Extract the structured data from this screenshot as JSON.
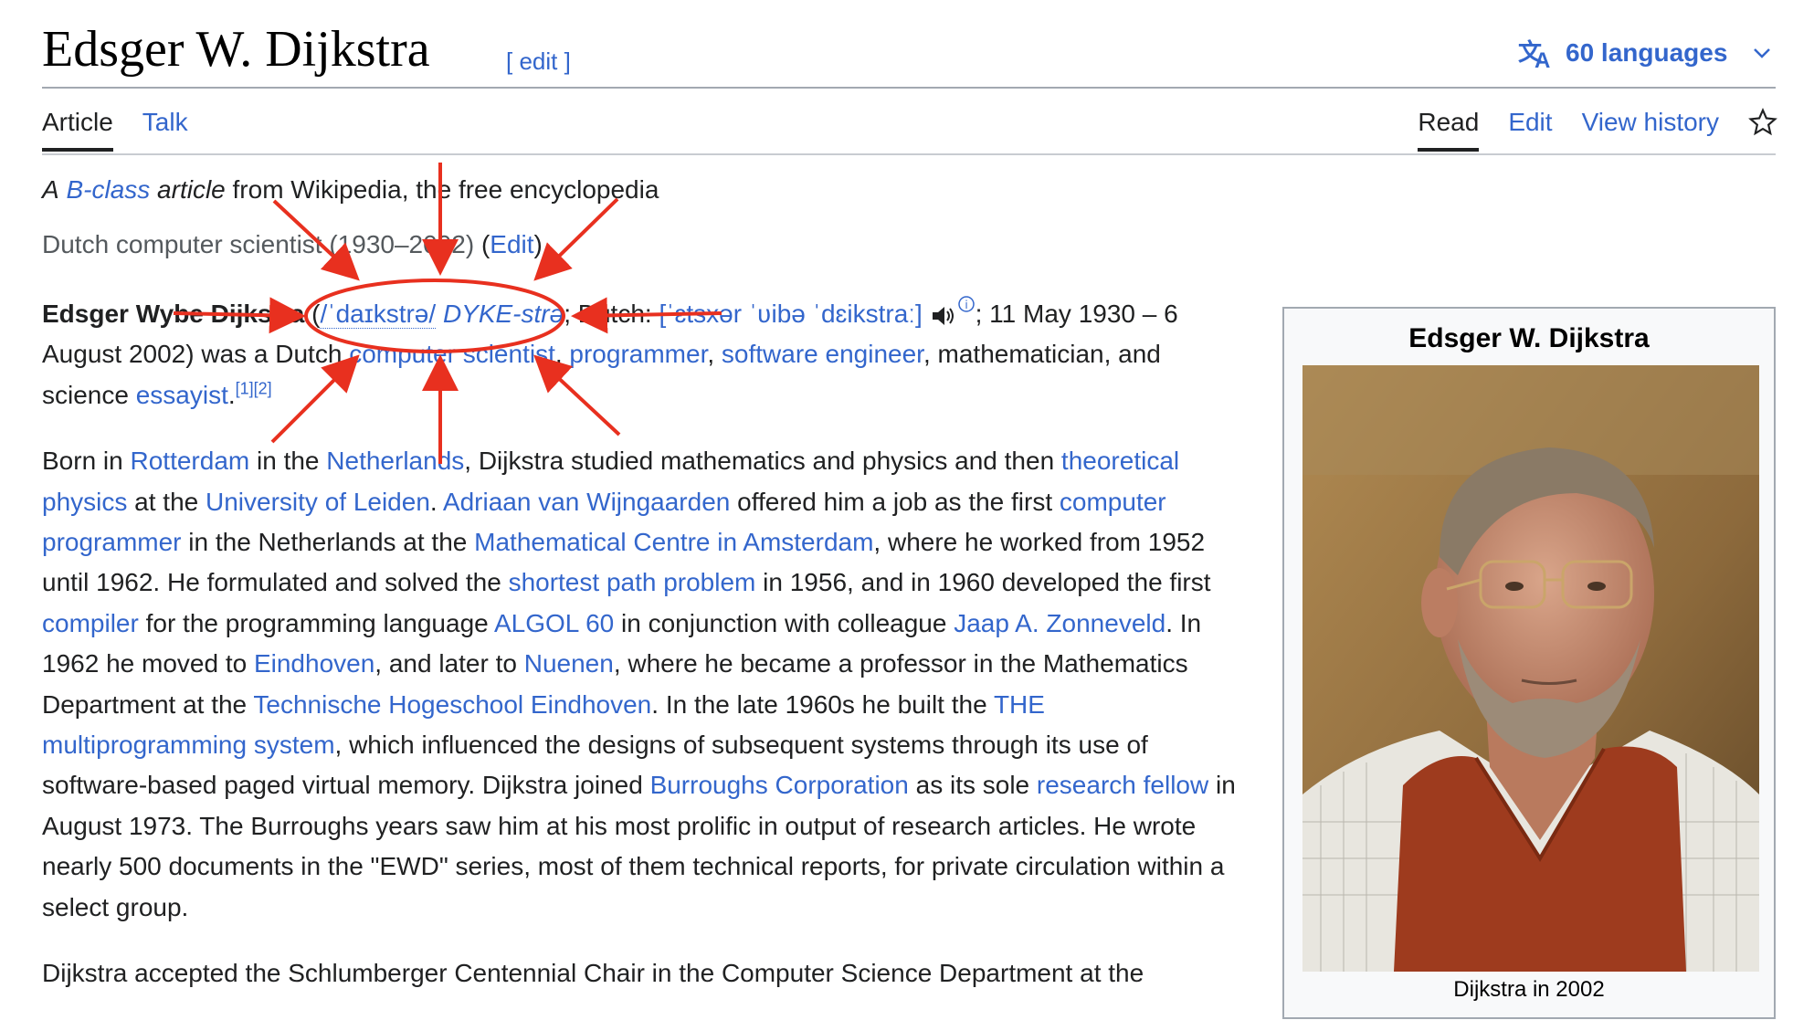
{
  "header": {
    "title": "Edsger W. Dijkstra",
    "edit_label": "[ edit ]",
    "languages_label": "60 languages"
  },
  "tabs": {
    "left": [
      {
        "label": "Article"
      },
      {
        "label": "Talk"
      }
    ],
    "right": [
      {
        "label": "Read"
      },
      {
        "label": "Edit"
      },
      {
        "label": "View history"
      }
    ]
  },
  "tagline": {
    "a": "A",
    "bclass": "B-class",
    "article_from": "article",
    "rest": "from Wikipedia, the free encyclopedia"
  },
  "short_description": {
    "text": "Dutch computer scientist (1930–2002)",
    "edit": "(Edit)"
  },
  "lead": {
    "name": "Edsger Wybe Dijkstra",
    "paren_open": " (",
    "ipa_en": "/ˈdaɪkstrə/",
    "respell": "DYKE-strə",
    "dutch_label": "; Dutch:",
    "ipa_nl": "[ˈɛtsxər ˈʋibə ˈdɛikstraː]",
    "dates": "; 11 May 1930 – 6 August 2002) was a Dutch",
    "computer_scientist": "computer scientist",
    "programmer": "programmer",
    "software_engineer": "software engineer",
    "tail": ", mathematician, and science",
    "essayist": "essayist",
    "refs": "[1][2]"
  },
  "para2": {
    "t1": "Born in",
    "rotterdam": "Rotterdam",
    "t2": "in the",
    "netherlands": "Netherlands",
    "t3": ", Dijkstra studied mathematics and physics and then",
    "theoretical_physics": "theoretical physics",
    "t4": "at the",
    "leiden": "University of Leiden",
    "t5": ".",
    "wijngaarden": "Adriaan van Wijngaarden",
    "t6": "offered him a job as the first",
    "programmer": "computer programmer",
    "t7": "in the Netherlands at the",
    "centre": "Mathematical Centre in Amsterdam",
    "t8": ", where he worked from 1952 until 1962. He formulated and solved the",
    "shortest": "shortest path problem",
    "t9": "in 1956, and in 1960 developed the first",
    "compiler": "compiler",
    "t10": "for the programming language",
    "algol": "ALGOL 60",
    "t11": "in conjunction with colleague",
    "zonneveld": "Jaap A. Zonneveld",
    "t12": ". In 1962 he moved to",
    "eindhoven": "Eindhoven",
    "t13": ", and later to",
    "nuenen": "Nuenen",
    "t14": ", where he became a professor in the Mathematics Department at the",
    "tue": "Technische Hogeschool Eindhoven",
    "t15": ". In the late 1960s he built the",
    "the_system": "THE multiprogramming system",
    "t16": ", which influenced the designs of subsequent systems through its use of software-based paged virtual memory. Dijkstra joined",
    "burroughs": "Burroughs Corporation",
    "t17": "as its sole",
    "fellow": "research fellow",
    "t18": "in August 1973. The Burroughs years saw him at his most prolific in output of research articles. He wrote nearly 500 documents in the \"EWD\" series, most of them technical reports, for private circulation within a select group."
  },
  "para3": {
    "t1": "Dijkstra accepted the Schlumberger Centennial Chair in the Computer Science Department at the"
  },
  "infobox": {
    "title": "Edsger W. Dijkstra",
    "caption": "Dijkstra in 2002"
  },
  "colors": {
    "link": "#3366cc",
    "annotation": "#e8301f",
    "infobox_bg": "#f8f9fa"
  }
}
